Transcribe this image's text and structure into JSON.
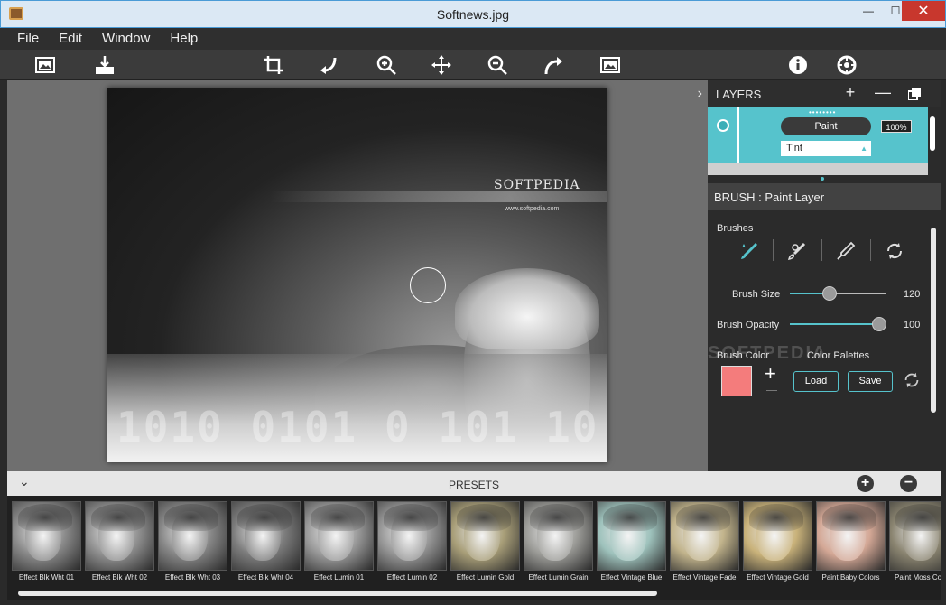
{
  "window": {
    "title": "Softnews.jpg",
    "minimize": "—",
    "maximize": "☐",
    "close": "✕"
  },
  "menu": [
    "File",
    "Edit",
    "Window",
    "Help"
  ],
  "toolbar": {
    "left": [
      "open-image-icon",
      "save-icon"
    ],
    "center": [
      "crop-icon",
      "undo-icon",
      "zoom-in-icon",
      "move-icon",
      "zoom-out-icon",
      "redo-icon",
      "fit-image-icon"
    ],
    "right": [
      "info-icon",
      "settings-icon"
    ]
  },
  "canvas": {
    "logo_text": "SOFTPEDIA",
    "logo_url": "www.softpedia.com",
    "digits": "1010 0101 0 101 10",
    "collapse_icon": "›"
  },
  "layers": {
    "title": "LAYERS",
    "add_label": "+",
    "remove_label": "—",
    "layer_name": "Paint",
    "opacity": "100%",
    "blend_mode": "Tint",
    "dots": "••••••••"
  },
  "brush": {
    "title": "BRUSH : Paint Layer",
    "brushes_label": "Brushes",
    "tools": [
      "paint-brush-icon",
      "eraser-brush-icon",
      "eyedropper-icon",
      "reset-icon"
    ],
    "size_label": "Brush Size",
    "size_value": "120",
    "size_level": 0.4,
    "opacity_label": "Brush Opacity",
    "opacity_value": "100",
    "opacity_level": 1.0,
    "color_label": "Brush Color",
    "palettes_label": "Color Palettes",
    "color": "#f47c7c",
    "load_label": "Load",
    "save_label": "Save",
    "watermark": "SOFTPEDIA"
  },
  "presets": {
    "title": "PRESETS",
    "add": "+",
    "remove": "−",
    "items": [
      {
        "name": "Effect Blk Wht 01",
        "tone": "#8a8a8a"
      },
      {
        "name": "Effect Blk Wht 02",
        "tone": "#909090"
      },
      {
        "name": "Effect Blk Wht 03",
        "tone": "#868686"
      },
      {
        "name": "Effect Blk Wht 04",
        "tone": "#7c7c7c"
      },
      {
        "name": "Effect Lumin 01",
        "tone": "#9a9a9a"
      },
      {
        "name": "Effect Lumin 02",
        "tone": "#959595"
      },
      {
        "name": "Effect Lumin Gold",
        "tone": "#a89e78"
      },
      {
        "name": "Effect Lumin Grain",
        "tone": "#9c9c98"
      },
      {
        "name": "Effect Vintage Blue",
        "tone": "#9ec2bc"
      },
      {
        "name": "Effect Vintage Fade",
        "tone": "#c2b48c"
      },
      {
        "name": "Effect Vintage Gold",
        "tone": "#c9b27a"
      },
      {
        "name": "Paint Baby Colors",
        "tone": "#d4a896"
      },
      {
        "name": "Paint Moss Colors",
        "tone": "#8a8470"
      }
    ]
  },
  "colors": {
    "accent": "#56c3cc",
    "panel": "#2b2b2b",
    "toolbar": "#3b3b3b"
  }
}
